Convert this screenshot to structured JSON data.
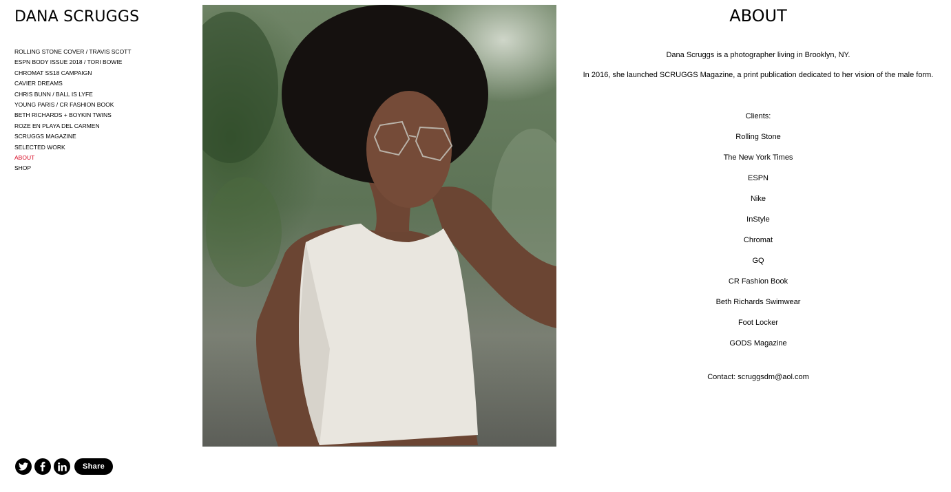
{
  "site": {
    "title": "DANA SCRUGGS"
  },
  "nav": {
    "items": [
      "ROLLING STONE COVER / TRAVIS SCOTT",
      "ESPN BODY ISSUE 2018 / TORI BOWIE",
      "CHROMAT SS18 CAMPAIGN",
      "CAVIER DREAMS",
      "CHRIS BUNN / BALL IS LYFE",
      "YOUNG PARIS / CR FASHION BOOK",
      "BETH RICHARDS + BOYKIN TWINS",
      "ROZE EN PLAYA DEL CARMEN",
      "SCRUGGS MAGAZINE",
      "SELECTED WORK",
      "ABOUT",
      "SHOP"
    ],
    "active": "ABOUT"
  },
  "about": {
    "heading": "ABOUT",
    "intro": [
      "Dana Scruggs is a photographer living in Brooklyn, NY.",
      "In 2016, she launched SCRUGGS Magazine, a print publication dedicated to her vision of the male form."
    ],
    "clients_label": "Clients:",
    "clients": [
      "Rolling Stone",
      "The New York Times",
      "ESPN",
      "Nike",
      "InStyle",
      "Chromat",
      "GQ",
      "CR Fashion Book",
      "Beth Richards Swimwear",
      "Foot Locker",
      "GODS Magazine"
    ],
    "contact": "Contact: scruggsdm@aol.com"
  },
  "share": {
    "icons": [
      "twitter-icon",
      "facebook-icon",
      "linkedin-icon"
    ],
    "button_label": "Share"
  },
  "colors": {
    "active_nav": "#d6001c",
    "button_bg": "#000000"
  }
}
